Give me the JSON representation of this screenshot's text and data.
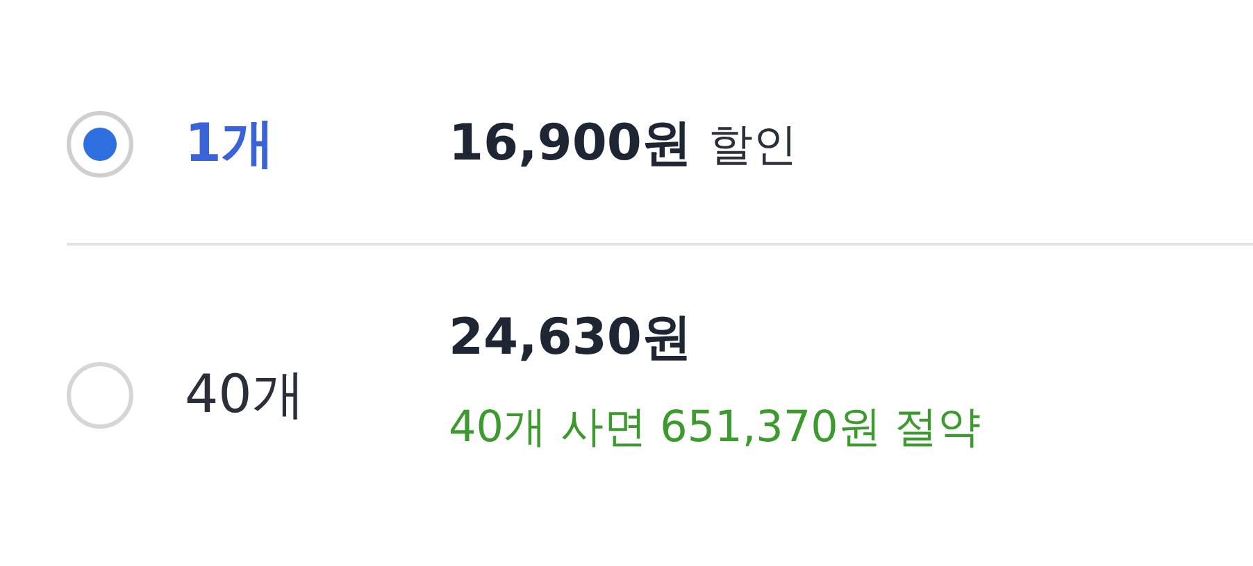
{
  "options": [
    {
      "quantity": "1개",
      "selected": true,
      "price": "16,900원",
      "price_suffix": "할인"
    },
    {
      "quantity": "40개",
      "selected": false,
      "price": "24,630원",
      "savings": "40개 사면 651,370원 절약"
    }
  ]
}
